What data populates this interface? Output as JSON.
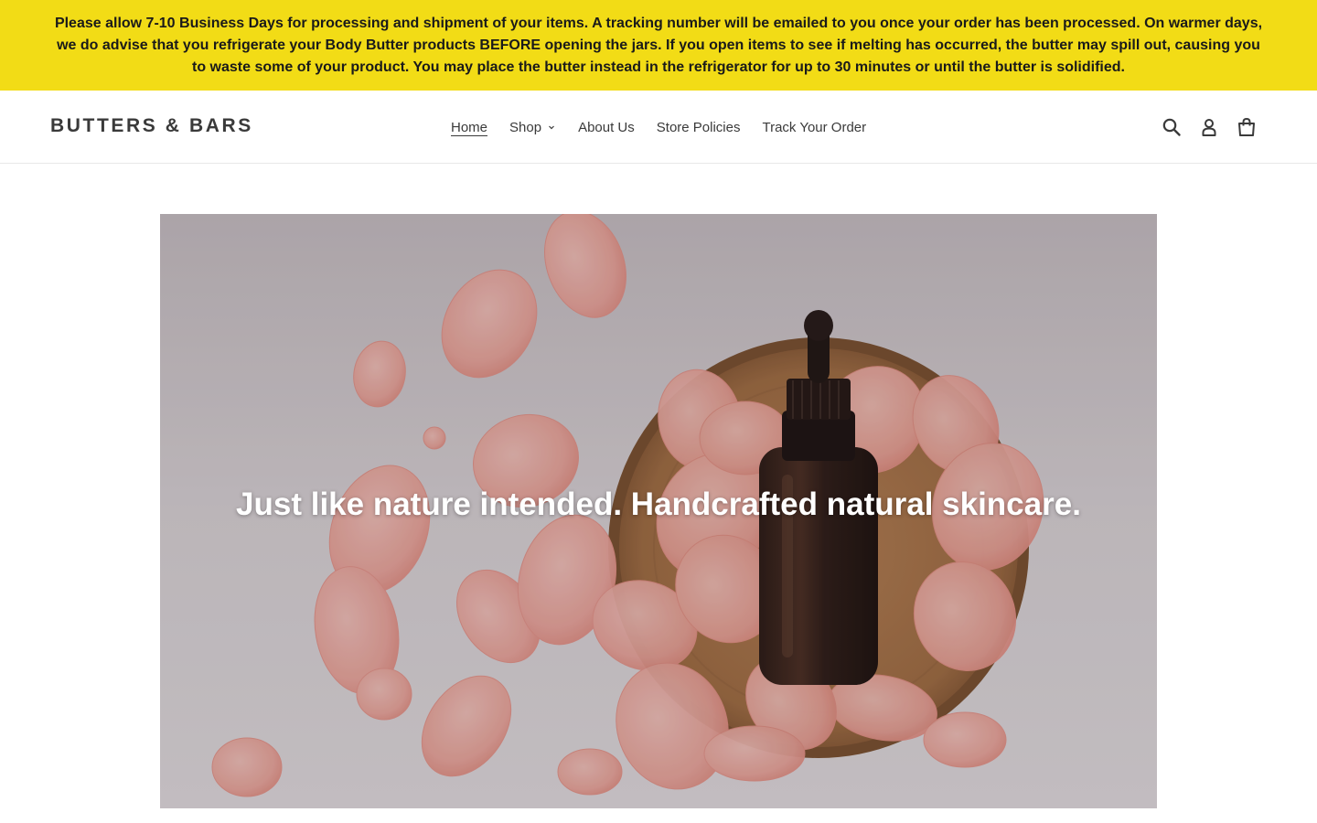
{
  "announcement": {
    "text": "Please allow 7-10 Business Days for processing and shipment of your items. A tracking number will be emailed to you once your order has been processed. On warmer days, we do advise that you refrigerate your Body Butter products BEFORE opening the jars. If you open items to see if melting has occurred, the butter may spill out, causing you to waste some of your product. You may place the butter instead in the refrigerator for up to 30 minutes or until the butter is solidified."
  },
  "header": {
    "logo": "BUTTERS & BARS",
    "nav": [
      {
        "label": "Home",
        "active": true
      },
      {
        "label": "Shop",
        "has_dropdown": true
      },
      {
        "label": "About Us"
      },
      {
        "label": "Store Policies"
      },
      {
        "label": "Track Your Order"
      }
    ],
    "icons": [
      "search-icon",
      "account-icon",
      "cart-icon"
    ]
  },
  "hero": {
    "title": "Just like nature intended. Handcrafted natural skincare."
  },
  "colors": {
    "announcement_bg": "#f2dc16",
    "text": "#3a3a3a",
    "hero_text": "#ffffff"
  }
}
